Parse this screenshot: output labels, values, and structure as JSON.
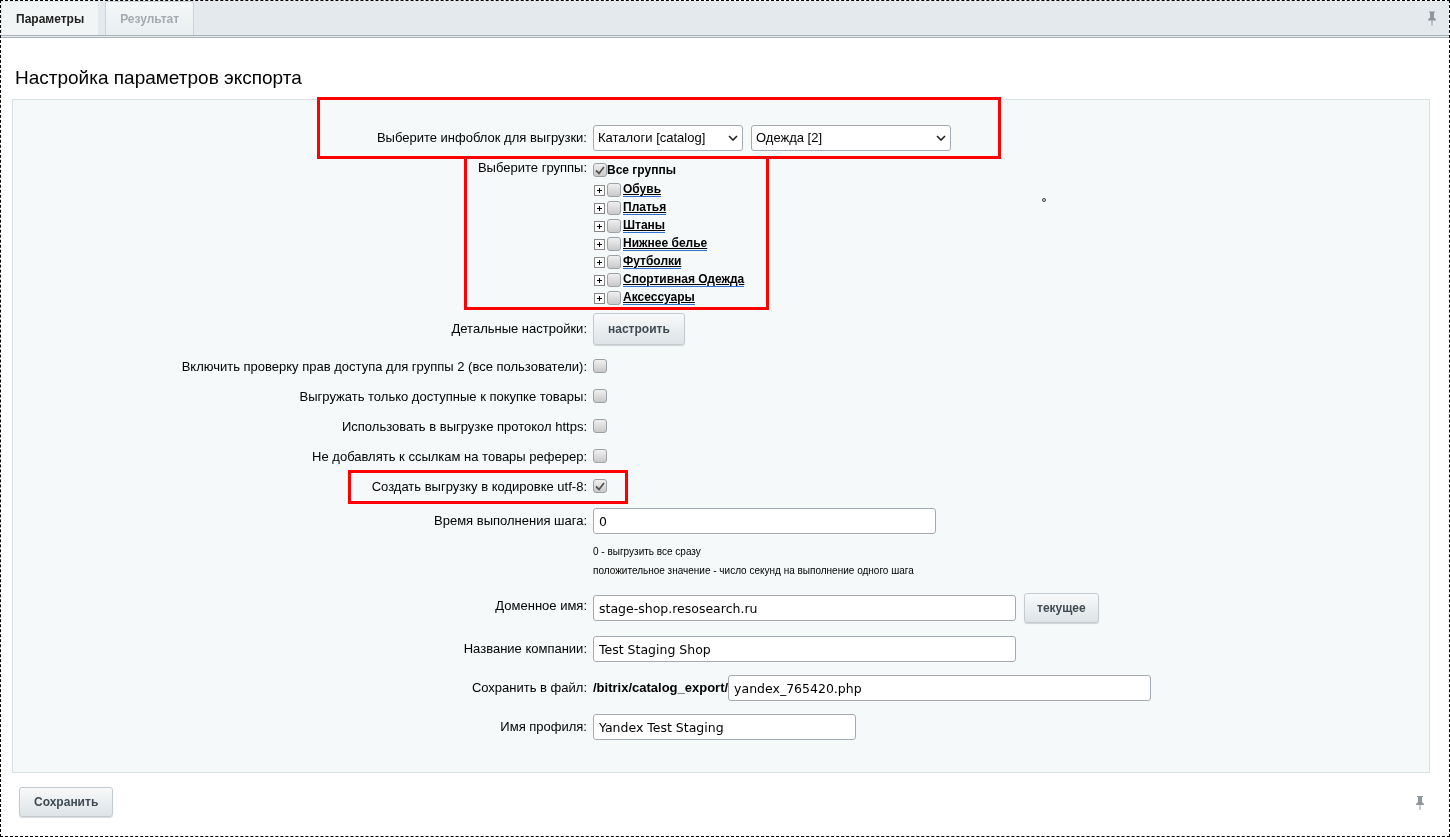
{
  "tabs": [
    {
      "label": "Параметры",
      "selected": true
    },
    {
      "label": "Результат",
      "selected": false
    }
  ],
  "title": "Настройка параметров экспорта",
  "rows": [
    {
      "kind": "selects",
      "label": "Выберите инфоблок для выгрузки:",
      "highlighted": true,
      "selects": [
        "Каталоги [catalog]",
        "Одежда [2]"
      ]
    },
    {
      "kind": "tree",
      "label": "Выберите группы:",
      "highlighted": true,
      "root": {
        "label": "Все группы",
        "checked": true
      },
      "children": [
        {
          "label": "Обувь",
          "checked": false
        },
        {
          "label": "Платья",
          "checked": false
        },
        {
          "label": "Штаны",
          "checked": false
        },
        {
          "label": "Нижнее белье",
          "checked": false
        },
        {
          "label": "Футболки",
          "checked": false
        },
        {
          "label": "Спортивная Одежда",
          "checked": false
        },
        {
          "label": "Аксессуары",
          "checked": false
        }
      ]
    },
    {
      "kind": "button",
      "label": "Детальные настройки:",
      "highlighted": false,
      "button": "настроить"
    },
    {
      "kind": "checkbox",
      "label": "Включить проверку прав доступа для группы 2 (все пользователи):",
      "highlighted": false,
      "checked": false
    },
    {
      "kind": "checkbox",
      "label": "Выгружать только доступные к покупке товары:",
      "highlighted": false,
      "checked": false
    },
    {
      "kind": "checkbox",
      "label": "Использовать в выгрузке протокол https:",
      "highlighted": false,
      "checked": false
    },
    {
      "kind": "checkbox",
      "label": "Не добавлять к ссылкам на товары реферер:",
      "highlighted": false,
      "checked": false
    },
    {
      "kind": "checkbox",
      "label": "Создать выгрузку в кодировке utf-8:",
      "highlighted": true,
      "checked": true
    },
    {
      "kind": "text",
      "label": "Время выполнения шага:",
      "highlighted": false,
      "value": "0",
      "hints": [
        "0 - выгрузить все сразу",
        "положительное значение - число секунд на выполнение одного шага"
      ]
    },
    {
      "kind": "text",
      "label": "Доменное имя:",
      "highlighted": false,
      "value": "stage-shop.resosearch.ru",
      "button": "текущее"
    },
    {
      "kind": "text",
      "label": "Название компании:",
      "highlighted": false,
      "value": "Test Staging Shop"
    },
    {
      "kind": "file",
      "label": "Сохранить в файл:",
      "highlighted": false,
      "prefix": "/bitrix/catalog_export/",
      "value": "yandex_765420.php"
    },
    {
      "kind": "text",
      "label": "Имя профиля:",
      "highlighted": false,
      "value": "Yandex Test Staging"
    }
  ],
  "save_button": "Сохранить"
}
